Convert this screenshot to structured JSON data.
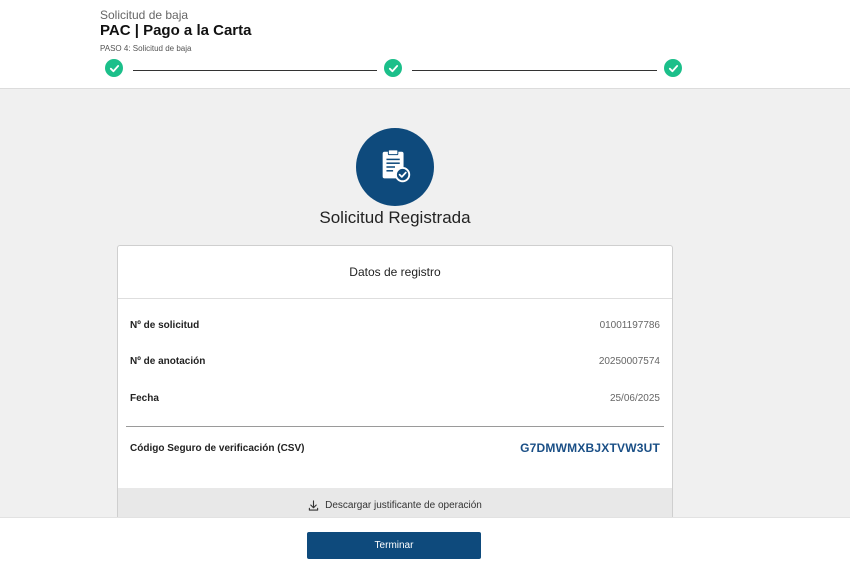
{
  "header": {
    "pre_title": "Solicitud de baja",
    "title": "PAC | Pago a la Carta",
    "step_caption": "PASO 4: Solicitud de baja",
    "steps_completed": 3
  },
  "hero": {
    "icon": "document-check-icon",
    "title": "Solicitud Registrada"
  },
  "card": {
    "title": "Datos de registro",
    "rows": [
      {
        "label": "Nº de solicitud",
        "value": "01001197786"
      },
      {
        "label": "Nº de anotación",
        "value": "20250007574"
      },
      {
        "label": "Fecha",
        "value": "25/06/2025"
      }
    ],
    "csv": {
      "label": "Código Seguro de verificación (CSV)",
      "value": "G7DMWMXBJXTVW3UT"
    },
    "download_label": "Descargar justificante de operación"
  },
  "footer": {
    "finish_label": "Terminar"
  },
  "colors": {
    "primary": "#0e4a7c",
    "success": "#1bbf8a",
    "csv_text": "#1a4f86"
  }
}
